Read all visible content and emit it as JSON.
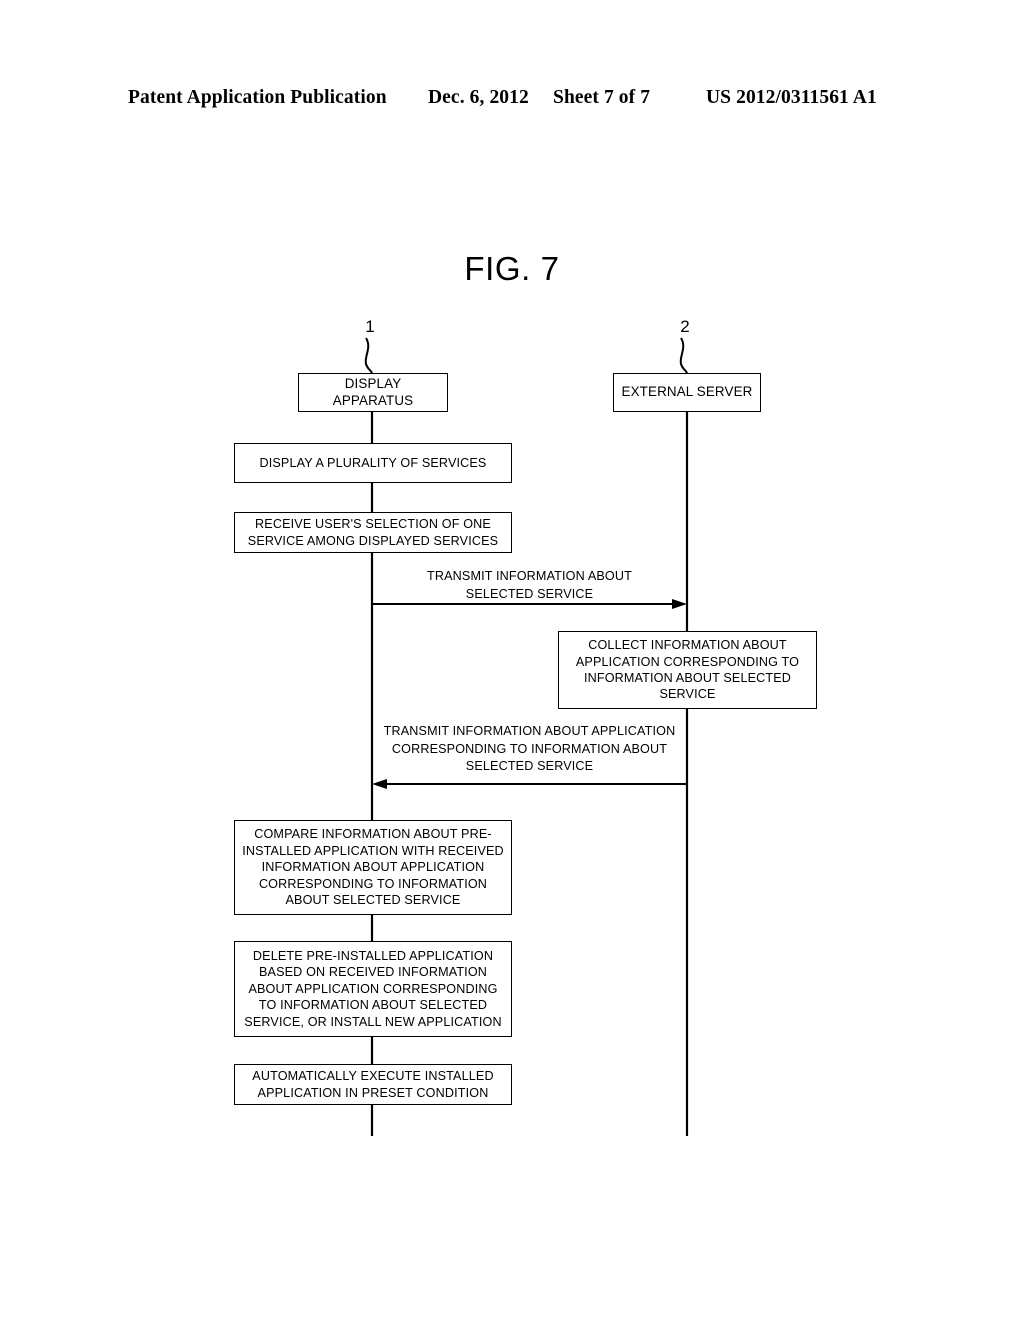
{
  "header": {
    "publication": "Patent Application Publication",
    "date": "Dec. 6, 2012",
    "sheet": "Sheet 7 of 7",
    "number": "US 2012/0311561 A1"
  },
  "figure": {
    "title": "FIG. 7",
    "reference_numerals": [
      {
        "id": "ref-1",
        "label": "1",
        "points_to": "DISPLAY APPARATUS"
      },
      {
        "id": "ref-2",
        "label": "2",
        "points_to": "EXTERNAL SERVER"
      }
    ],
    "actors": [
      {
        "id": "display-apparatus",
        "label": "DISPLAY APPARATUS"
      },
      {
        "id": "external-server",
        "label": "EXTERNAL SERVER"
      }
    ],
    "steps": [
      {
        "id": "display-services",
        "lane": "display-apparatus",
        "label": "DISPLAY A PLURALITY OF SERVICES"
      },
      {
        "id": "receive-selection",
        "lane": "display-apparatus",
        "label": "RECEIVE USER'S SELECTION OF ONE SERVICE AMONG DISPLAYED SERVICES"
      },
      {
        "id": "collect-information",
        "lane": "external-server",
        "label": "COLLECT INFORMATION ABOUT APPLICATION CORRESPONDING TO INFORMATION ABOUT SELECTED SERVICE"
      },
      {
        "id": "compare-information",
        "lane": "display-apparatus",
        "label": "COMPARE INFORMATION ABOUT PRE-INSTALLED APPLICATION WITH RECEIVED INFORMATION ABOUT APPLICATION CORRESPONDING TO INFORMATION ABOUT SELECTED SERVICE"
      },
      {
        "id": "delete-or-install",
        "lane": "display-apparatus",
        "label": "DELETE PRE-INSTALLED APPLICATION BASED ON RECEIVED INFORMATION ABOUT APPLICATION CORRESPONDING TO INFORMATION ABOUT SELECTED SERVICE, OR INSTALL NEW APPLICATION"
      },
      {
        "id": "auto-execute",
        "lane": "display-apparatus",
        "label": "AUTOMATICALLY EXECUTE INSTALLED APPLICATION IN PRESET CONDITION"
      }
    ],
    "messages": [
      {
        "id": "transmit-selected-service",
        "from": "display-apparatus",
        "to": "external-server",
        "direction": "right",
        "label": "TRANSMIT INFORMATION ABOUT SELECTED SERVICE"
      },
      {
        "id": "transmit-application-info",
        "from": "external-server",
        "to": "display-apparatus",
        "direction": "left",
        "label": "TRANSMIT INFORMATION ABOUT APPLICATION CORRESPONDING TO INFORMATION ABOUT SELECTED SERVICE"
      }
    ],
    "colors": {
      "ink": "#000000",
      "paper": "#ffffff"
    }
  }
}
